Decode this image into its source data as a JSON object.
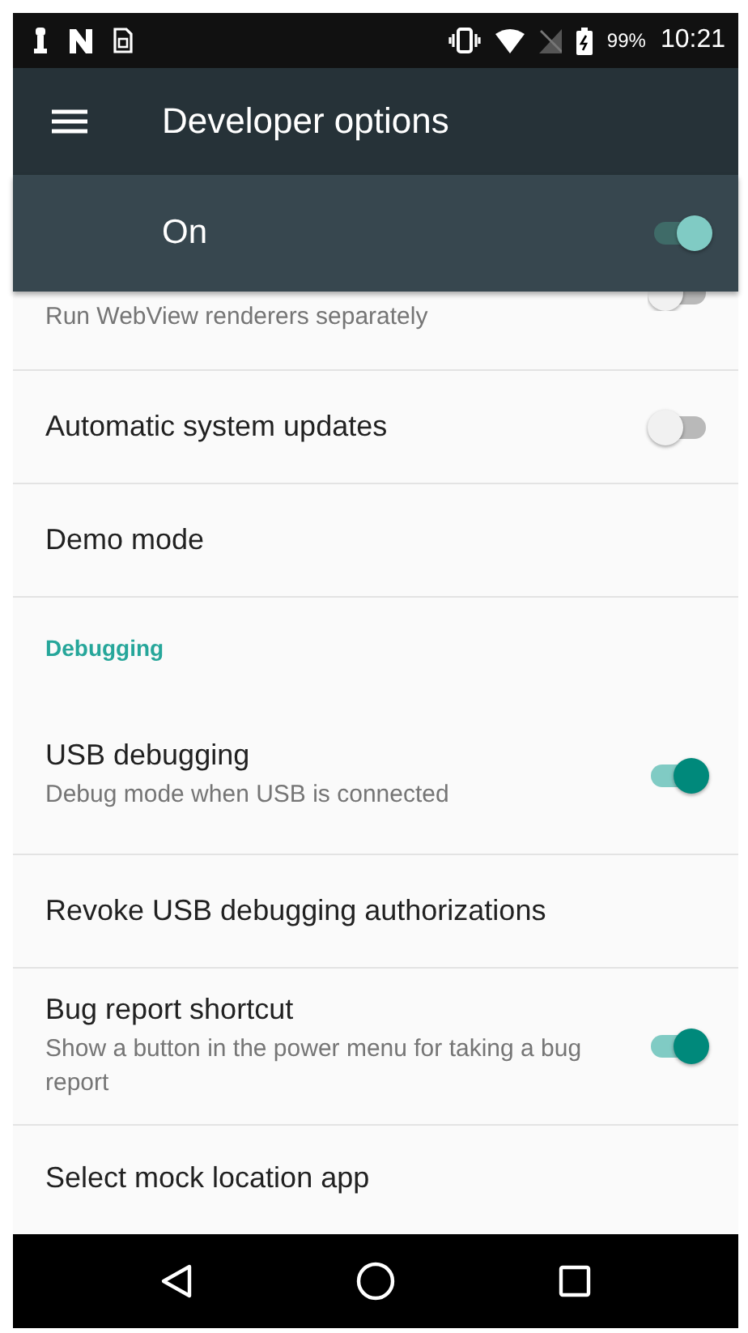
{
  "status_bar": {
    "battery": "99%",
    "time": "10:21"
  },
  "toolbar": {
    "title": "Developer options"
  },
  "master_switch": {
    "label": "On",
    "on": true
  },
  "settings": [
    {
      "kind": "cut_toggle",
      "subtitle": "Run WebView renderers separately",
      "on": false
    },
    {
      "kind": "toggle",
      "title": "Automatic system updates",
      "on": false
    },
    {
      "kind": "item",
      "title": "Demo mode"
    },
    {
      "kind": "header",
      "title": "Debugging"
    },
    {
      "kind": "toggle",
      "title": "USB debugging",
      "subtitle": "Debug mode when USB is connected",
      "on": true
    },
    {
      "kind": "item",
      "title": "Revoke USB debugging authorizations"
    },
    {
      "kind": "toggle",
      "title": "Bug report shortcut",
      "subtitle": "Show a button in the power menu for taking a bug report",
      "on": true
    },
    {
      "kind": "cut_item",
      "title": "Select mock location app"
    }
  ]
}
